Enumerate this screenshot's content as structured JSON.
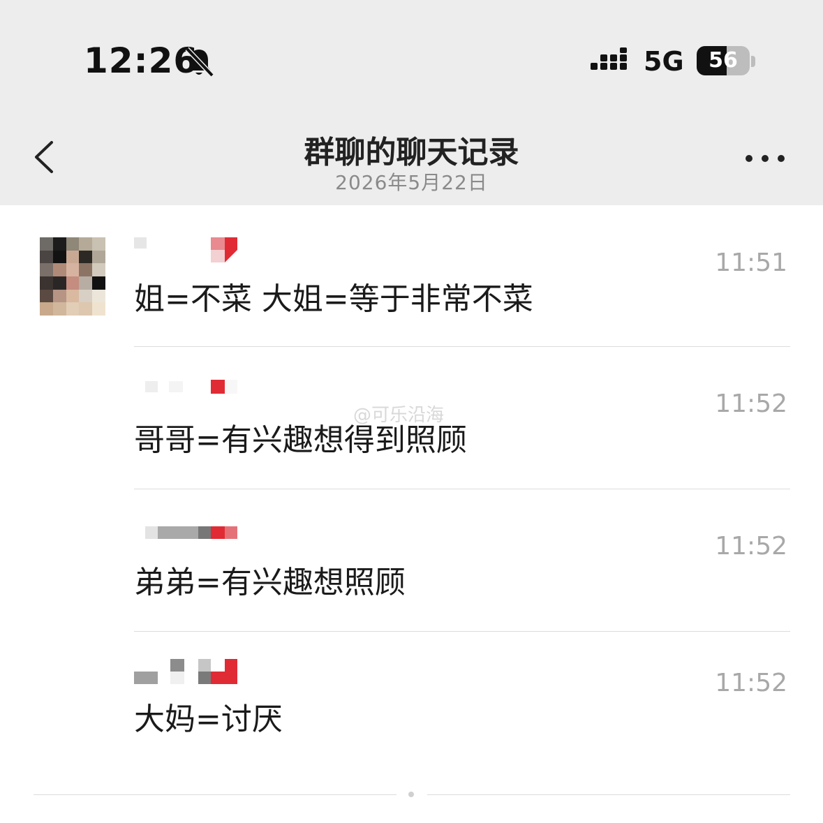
{
  "status_bar": {
    "time": "12:26",
    "network": "5G",
    "battery": "56",
    "battery_level_percent": 56,
    "icons": [
      "bell-muted-icon",
      "signal-icon"
    ]
  },
  "header": {
    "title": "群聊的聊天记录",
    "date": "2026年5月22日",
    "icons": [
      "back-chevron-icon",
      "more-dots-icon"
    ]
  },
  "messages": [
    {
      "time": "11:51",
      "text": "姐=不菜 大姐=等于非常不菜"
    },
    {
      "time": "11:52",
      "text": "哥哥=有兴趣想得到照顾"
    },
    {
      "time": "11:52",
      "text": "弟弟=有兴趣想照顾"
    },
    {
      "time": "11:52",
      "text": "大妈=讨厌"
    }
  ],
  "watermark": "@可乐沿海",
  "colors": {
    "header_bg": "#ededed",
    "time_text": "#a8a8a8",
    "divider": "#dcdcdc"
  }
}
